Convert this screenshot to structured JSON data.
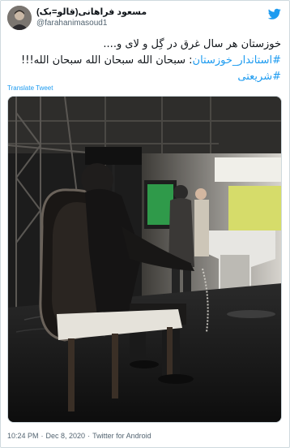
{
  "user": {
    "display_name": "مسعود فراهانی(قالو=بک)",
    "handle": "@farahanimasoud1"
  },
  "tweet": {
    "line1": "خوزستان هر سال غرق در گِل و لای و....",
    "line2_hashtag": "#استاندار_خوزستان",
    "line2_rest": ": سبحان الله سبحان الله سبحان الله!!!",
    "line3_hashtag": "#شریعتی",
    "translate_label": "Translate Tweet"
  },
  "meta": {
    "time": "10:24 PM",
    "date": "Dec 8, 2020",
    "source": "Twitter for Android",
    "separator": "·"
  },
  "colors": {
    "link": "#1d9bf0",
    "text": "#0f1419",
    "muted": "#536471"
  },
  "icons": {
    "logo": "twitter-bird-icon"
  }
}
